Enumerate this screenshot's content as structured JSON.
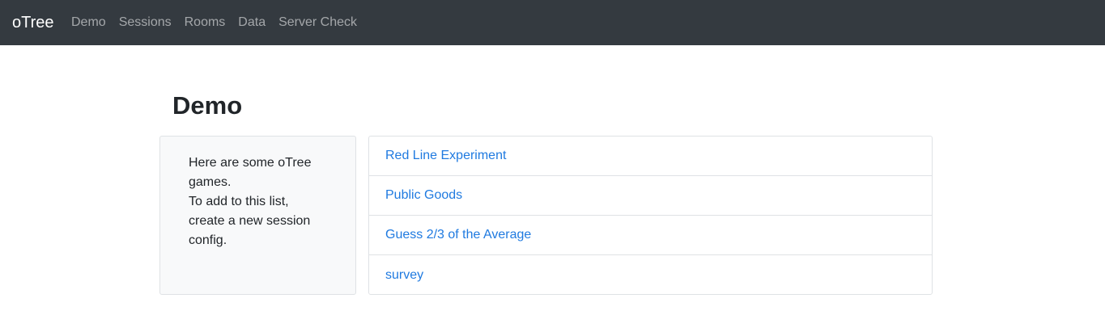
{
  "navbar": {
    "brand": "oTree",
    "links": [
      {
        "label": "Demo"
      },
      {
        "label": "Sessions"
      },
      {
        "label": "Rooms"
      },
      {
        "label": "Data"
      },
      {
        "label": "Server Check"
      }
    ]
  },
  "main": {
    "title": "Demo",
    "info_lines": [
      "Here are some oTree",
      "games.",
      "To add to this list,",
      "create a new session",
      "config."
    ],
    "session_configs": [
      {
        "label": "Red Line Experiment"
      },
      {
        "label": "Public Goods"
      },
      {
        "label": "Guess 2/3 of the Average"
      },
      {
        "label": "survey"
      }
    ]
  },
  "colors": {
    "navbar_bg": "#343a40",
    "link": "#1f7ae0",
    "card_bg": "#f8f9fa",
    "border": "#dfe2e5"
  }
}
